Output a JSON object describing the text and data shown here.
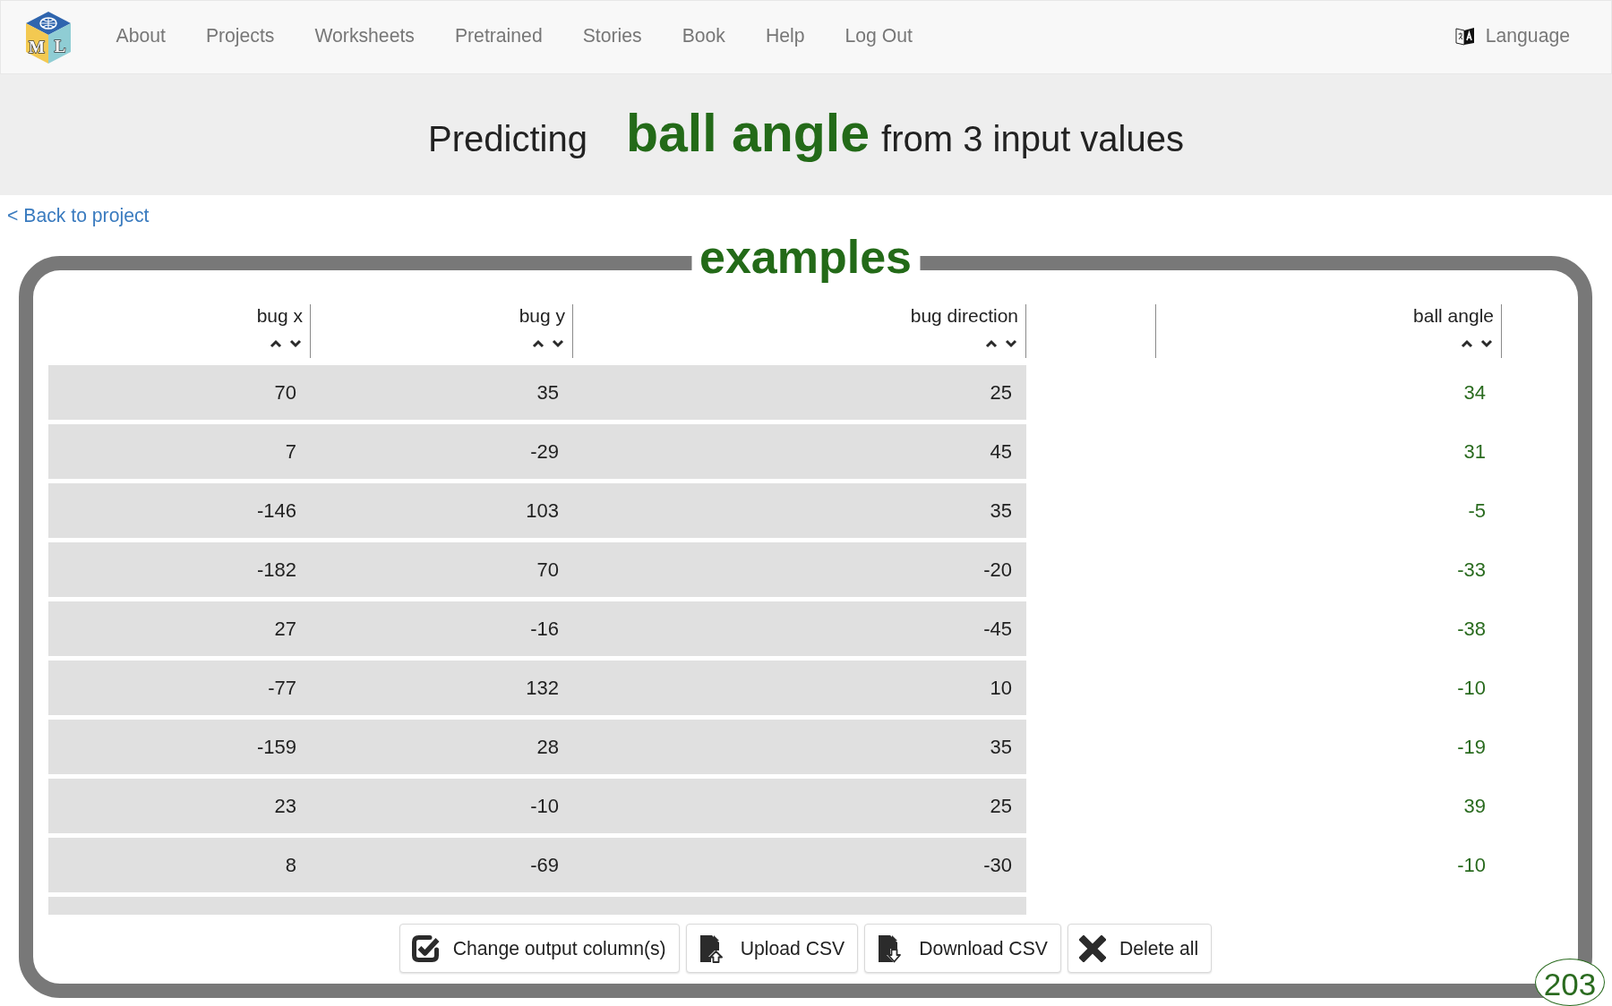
{
  "navbar": {
    "logo": {
      "letters": [
        "M",
        "L"
      ]
    },
    "links": [
      {
        "label": "About"
      },
      {
        "label": "Projects"
      },
      {
        "label": "Worksheets"
      },
      {
        "label": "Pretrained"
      },
      {
        "label": "Stories"
      },
      {
        "label": "Book"
      },
      {
        "label": "Help"
      },
      {
        "label": "Log Out"
      }
    ],
    "language": "Language"
  },
  "heading": {
    "prefix": "Predicting",
    "target": "ball angle",
    "suffix": "from 3 input values"
  },
  "back_link": "< Back to project",
  "examples": {
    "title": "examples",
    "table": {
      "columns": [
        {
          "label": "bug x",
          "kind": "input"
        },
        {
          "label": "bug y",
          "kind": "input"
        },
        {
          "label": "bug direction",
          "kind": "input"
        },
        {
          "kind": "blank"
        },
        {
          "label": "ball angle",
          "kind": "output"
        }
      ],
      "rows": [
        {
          "cells": [
            "70",
            "35",
            "25",
            "34"
          ]
        },
        {
          "cells": [
            "7",
            "-29",
            "45",
            "31"
          ]
        },
        {
          "cells": [
            "-146",
            "103",
            "35",
            "-5"
          ]
        },
        {
          "cells": [
            "-182",
            "70",
            "-20",
            "-33"
          ]
        },
        {
          "cells": [
            "27",
            "-16",
            "-45",
            "-38"
          ]
        },
        {
          "cells": [
            "-77",
            "132",
            "10",
            "-10"
          ]
        },
        {
          "cells": [
            "-159",
            "28",
            "35",
            "-19"
          ]
        },
        {
          "cells": [
            "23",
            "-10",
            "25",
            "39"
          ]
        },
        {
          "cells": [
            "8",
            "-69",
            "-30",
            "-10"
          ]
        }
      ],
      "partial_row_below": true
    },
    "buttons": [
      {
        "label": "Change output column(s)",
        "kind": "columns"
      },
      {
        "label": "Upload CSV",
        "kind": "upload"
      },
      {
        "label": "Download CSV",
        "kind": "download"
      },
      {
        "label": "Delete all",
        "kind": "delete"
      }
    ]
  },
  "example_count": "203"
}
